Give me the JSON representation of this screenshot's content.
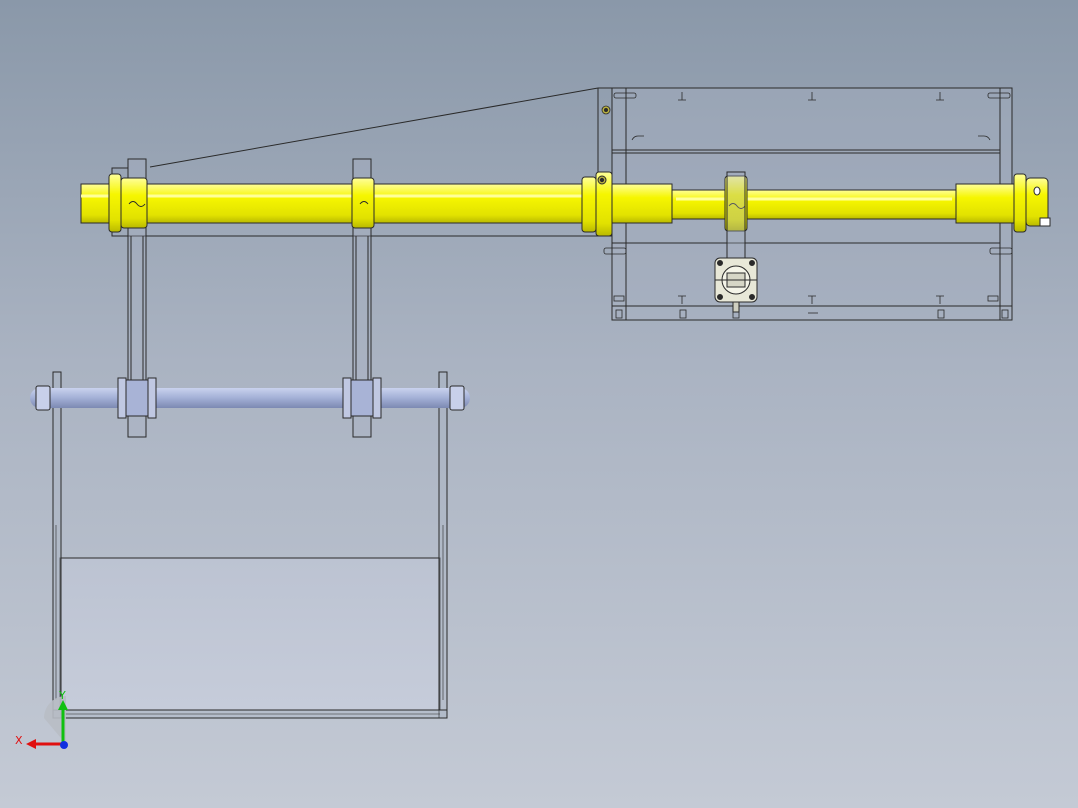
{
  "viewport": {
    "background_top": "#8a98a9",
    "background_bottom": "#c4cad5"
  },
  "colors": {
    "shaft": "#f2f200",
    "shaft_shade": "#c8c800",
    "shaft_highlight": "#ffff7a",
    "rod": "#a7b4d6",
    "rod_shade": "#7f8db8",
    "panel_fill": "#c2c8d8",
    "line": "#2a2a2a",
    "axis_x": "#e01010",
    "axis_y": "#10c010",
    "axis_z": "#1030e0"
  },
  "triad": {
    "x_label": "X",
    "y_label": "Y"
  },
  "parts": {
    "yellow_shaft": "yellow-shaft",
    "lower_rod": "lower-rod",
    "bucket": "bucket-frame",
    "housing": "right-housing",
    "bearing_block": "bearing-block"
  }
}
